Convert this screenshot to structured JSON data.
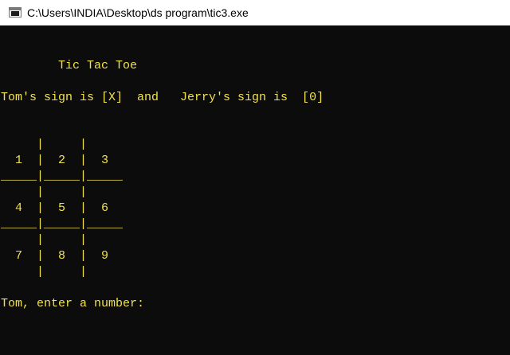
{
  "window": {
    "title": "C:\\Users\\INDIA\\Desktop\\ds program\\tic3.exe",
    "icon": "console-app-icon"
  },
  "console": {
    "text_color": "#f2e24a",
    "background": "#0c0c0c",
    "heading": "        Tic Tac Toe",
    "signs_line": "Tom's sign is [X]  and   Jerry's sign is  [0]",
    "board": {
      "row1_top": "     |     |",
      "row1": "  1  |  2  |  3",
      "row1_bottom": "_____|_____|_____",
      "row2_top": "     |     |",
      "row2": "  4  |  5  |  6",
      "row2_bottom": "_____|_____|_____",
      "row3_top": "     |     |",
      "row3": "  7  |  8  |  9",
      "row3_bottom": "     |     |"
    },
    "prompt": "Tom, enter a number:"
  }
}
